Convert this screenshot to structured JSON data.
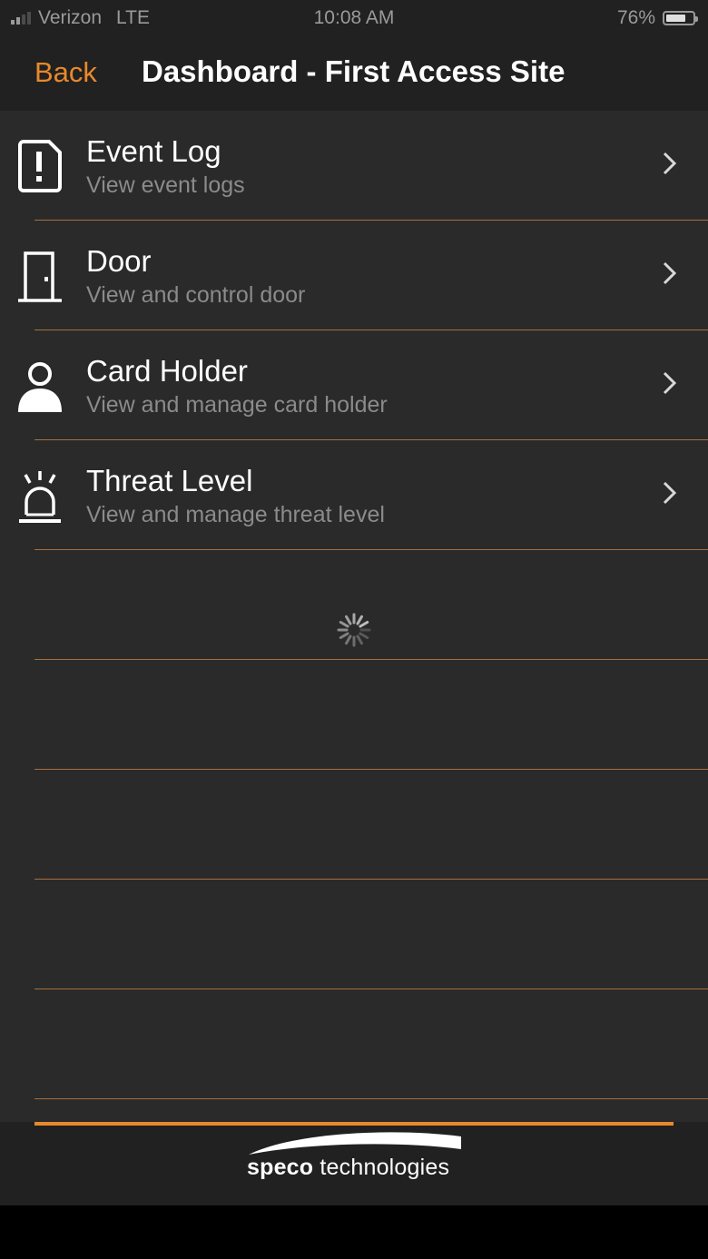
{
  "status_bar": {
    "carrier": "Verizon",
    "network": "LTE",
    "time": "10:08 AM",
    "battery": "76%",
    "battery_level": 0.76
  },
  "nav": {
    "back_label": "Back",
    "title": "Dashboard - First Access Site"
  },
  "menu": [
    {
      "title": "Event Log",
      "subtitle": "View event logs",
      "icon": "alert-icon"
    },
    {
      "title": "Door",
      "subtitle": "View and control door",
      "icon": "door-icon"
    },
    {
      "title": "Card Holder",
      "subtitle": "View and manage card holder",
      "icon": "person-icon"
    },
    {
      "title": "Threat Level",
      "subtitle": "View and manage threat level",
      "icon": "siren-icon"
    }
  ],
  "footer": {
    "logo_brand": "speco",
    "logo_suffix": " technologies"
  },
  "colors": {
    "accent": "#e8892c",
    "background": "#2a2a2b",
    "bar": "#212121",
    "subtitle": "#8b8b8b"
  }
}
